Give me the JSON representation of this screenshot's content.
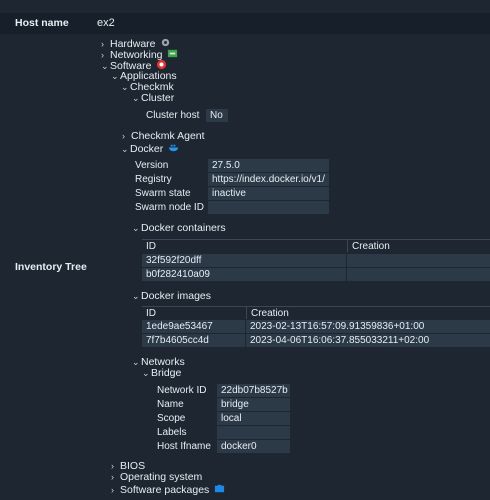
{
  "host": {
    "label": "Host name",
    "value": "ex2"
  },
  "inventory_label": "Inventory Tree",
  "tree": {
    "hardware": "Hardware",
    "networking": "Networking",
    "software": "Software",
    "applications": "Applications",
    "checkmk": "Checkmk",
    "cluster": "Cluster",
    "cluster_host": {
      "label": "Cluster host",
      "value": "No"
    },
    "checkmk_agent": "Checkmk Agent",
    "docker": "Docker",
    "docker_props": [
      {
        "key": "Version",
        "value": "27.5.0"
      },
      {
        "key": "Registry",
        "value": "https://index.docker.io/v1/"
      },
      {
        "key": "Swarm state",
        "value": "inactive"
      },
      {
        "key": "Swarm node ID",
        "value": ""
      }
    ],
    "docker_containers": {
      "title": "Docker containers",
      "headers": [
        "ID",
        "Creation"
      ],
      "rows": [
        [
          "32f592f20dff",
          ""
        ],
        [
          "b0f282410a09",
          ""
        ]
      ]
    },
    "docker_images": {
      "title": "Docker images",
      "headers": [
        "ID",
        "Creation"
      ],
      "rows": [
        [
          "1ede9ae53467",
          "2023-02-13T16:57:09.91359836+01:00"
        ],
        [
          "7f7b4605cc4d",
          "2023-04-06T16:06:37.855033211+02:00"
        ]
      ]
    },
    "networks": "Networks",
    "bridge": "Bridge",
    "bridge_props": [
      {
        "key": "Network ID",
        "value": "22db07b8527b"
      },
      {
        "key": "Name",
        "value": "bridge"
      },
      {
        "key": "Scope",
        "value": "local"
      },
      {
        "key": "Labels",
        "value": ""
      },
      {
        "key": "Host Ifname",
        "value": "docker0"
      }
    ],
    "bios": "BIOS",
    "operating_system": "Operating system",
    "software_packages": "Software packages"
  },
  "icons": {
    "hardware": "gear-icon",
    "networking": "network-icon",
    "software": "software-icon",
    "docker": "docker-whale-icon",
    "software_packages": "package-icon"
  },
  "colors": {
    "background": "#1e2731",
    "value_cell": "#2c3a48",
    "header_row": "#17202a"
  }
}
